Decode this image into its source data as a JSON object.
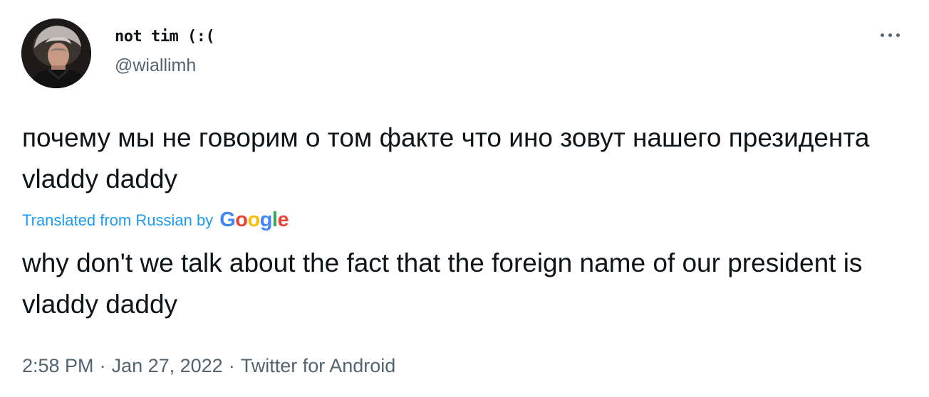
{
  "tweet": {
    "display_name": "not tim (:(",
    "handle": "@wiallimh",
    "original_text": "почему мы не говорим о том факте что ино зовут нашего президента vladdy daddy",
    "translation_label": "Translated from Russian by",
    "translation_provider": "Google",
    "translated_text": "why don't we talk about the fact that the foreign name of our president is vladdy daddy",
    "time": "2:58 PM",
    "separator": "·",
    "date": "Jan 27, 2022",
    "source": "Twitter for Android"
  },
  "icons": {
    "more": "more-dots-icon",
    "logo": "google-logo"
  },
  "colors": {
    "link": "#1d9bf0",
    "secondary_text": "#536471",
    "primary_text": "#0f1419",
    "google_blue": "#4285f4",
    "google_red": "#ea4335",
    "google_yellow": "#fbbc05",
    "google_green": "#34a853"
  }
}
